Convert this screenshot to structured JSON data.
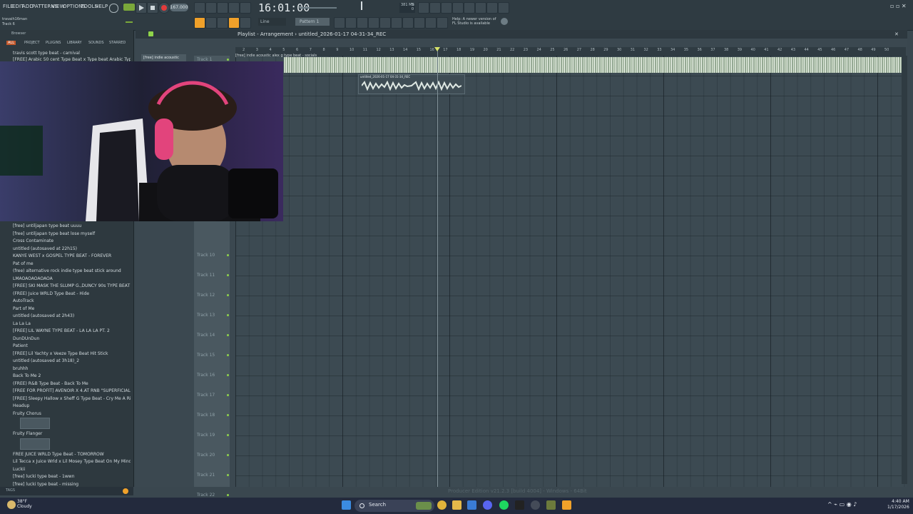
{
  "menu": {
    "items": [
      "FILE",
      "EDIT",
      "ADD",
      "PATTERNS",
      "VIEW",
      "OPTIONS",
      "TOOLS",
      "HELP"
    ]
  },
  "transport": {
    "tempo": "167.000",
    "time": "16:01:00",
    "pattern": "Pattern 1",
    "snap": "Line",
    "cpu": "5",
    "mem": "381 MB",
    "cpu2": "0"
  },
  "hint": {
    "line1": "Help: A newer version of",
    "line2": "FL Studio is available"
  },
  "track": {
    "owner": "travaih16man",
    "name": "Track 6"
  },
  "browser": {
    "title": "Browser",
    "tabs": [
      "ALL",
      "PROJECT",
      "PLUGINS",
      "LIBRARY",
      "SOUNDS",
      "STARRED"
    ],
    "top_items": [
      "travis scott type beat - carnival",
      "[FREE] Arabic 50 cent Type Beat x Type beat Arabic Type beat"
    ],
    "items": [
      {
        "label": "[free] untiljapan type beat uuuu",
        "kind": "project"
      },
      {
        "label": "[free] untiljapan type beat lose myself",
        "kind": "project"
      },
      {
        "label": "Cross Contaminate",
        "kind": "project"
      },
      {
        "label": "untitled (autosaved at 22h15)",
        "kind": "project"
      },
      {
        "label": "KANYE WEST x GOSPEL TYPE BEAT - FOREVER",
        "kind": "project"
      },
      {
        "label": "Pat of me",
        "kind": "project"
      },
      {
        "label": "(free) alternative rock  indie type beat stick around",
        "kind": "project"
      },
      {
        "label": "LMAOAOAOAOAOA",
        "kind": "project"
      },
      {
        "label": "[FREE] SKI MASK THE SLUMP G.,DUNCY 90s TYPE BEAT BURST!",
        "kind": "project"
      },
      {
        "label": "(FREE) Juice WRLD Type Beat - Hide",
        "kind": "project"
      },
      {
        "label": "AutoTrack",
        "kind": "plugin"
      },
      {
        "label": "Part of Me",
        "kind": "project"
      },
      {
        "label": "untitled (autosaved at 2h43)",
        "kind": "project"
      },
      {
        "label": "La La La",
        "kind": "project"
      },
      {
        "label": "[FREE] LIL WAYNE TYPE BEAT - LA LA LA PT. 2",
        "kind": "project"
      },
      {
        "label": "DunDUnDun",
        "kind": "project"
      },
      {
        "label": "Patient",
        "kind": "project"
      },
      {
        "label": "[FREE] Lil Yachty x Veeze Type Beat Hit Stick",
        "kind": "project"
      },
      {
        "label": "untitled (autosaved at 3h18)_2",
        "kind": "project"
      },
      {
        "label": "bruhhh",
        "kind": "project"
      },
      {
        "label": "Back To Me 2",
        "kind": "project"
      },
      {
        "label": "(FREE) R&B Type Beat - Back To Me",
        "kind": "project"
      },
      {
        "label": "[FREE FOR PROFIT] AVENOIR X 4.AT  RNB  \"SUPERFICIAL LUV\"",
        "kind": "project"
      },
      {
        "label": "[FREE] Sleepy Hallow x Sheff G Type Beat - Cry Me A River",
        "kind": "project"
      },
      {
        "label": "Headup",
        "kind": "project"
      },
      {
        "label": "Fruity Chorus",
        "kind": "plugin"
      },
      {
        "label": "Fruity Flanger",
        "kind": "plugin"
      },
      {
        "label": "FREE JUICE WRLD Type Beat - TOMORROW",
        "kind": "project"
      },
      {
        "label": "Lil Tecca x Juice Wrld x Lil Mosey Type Beat On My Mind",
        "kind": "project"
      },
      {
        "label": "Luckii",
        "kind": "project"
      },
      {
        "label": "[free] lucki type beat - 1wwn",
        "kind": "project"
      },
      {
        "label": "[free] lucki type beat - missing",
        "kind": "project"
      }
    ],
    "tags_label": "TAGS"
  },
  "playlist": {
    "title": "Playlist - Arrangement",
    "project": "untitled_2026-01-17 04-31-34_REC",
    "pattern_selector": "[free] indie acoustic",
    "audio_label": "[free] indie acoustic alex g type beat - socials",
    "clip_label": "untitled_2026-01-17 04-31-34_REC",
    "bars": [
      "2",
      "3",
      "4",
      "5",
      "6",
      "7",
      "8",
      "9",
      "10",
      "11",
      "12",
      "13",
      "14",
      "15",
      "16",
      "17",
      "18",
      "19",
      "20",
      "21",
      "22",
      "23",
      "24",
      "25",
      "26",
      "27",
      "28",
      "29",
      "30",
      "31",
      "32",
      "33",
      "34",
      "35",
      "36",
      "37",
      "38",
      "39",
      "40",
      "41",
      "42",
      "43",
      "44",
      "45",
      "46",
      "47",
      "48",
      "49",
      "50"
    ],
    "tracks": [
      "Track 1",
      "Track 10",
      "Track 11",
      "Track 12",
      "Track 13",
      "Track 14",
      "Track 15",
      "Track 16",
      "Track 17",
      "Track 18",
      "Track 19",
      "Track 20",
      "Track 21",
      "Track 22"
    ],
    "status": "Producer Edition v21.2.3 [build 4004] - Windows - 64Bit"
  },
  "taskbar": {
    "temp": "38°F",
    "weather": "Cloudy",
    "search": "Search",
    "time": "4:40 AM",
    "date": "1/17/2026"
  },
  "colors": {
    "accent_orange": "#f0a12a",
    "record_red": "#e23b3b",
    "track_green": "#8fd44a"
  }
}
